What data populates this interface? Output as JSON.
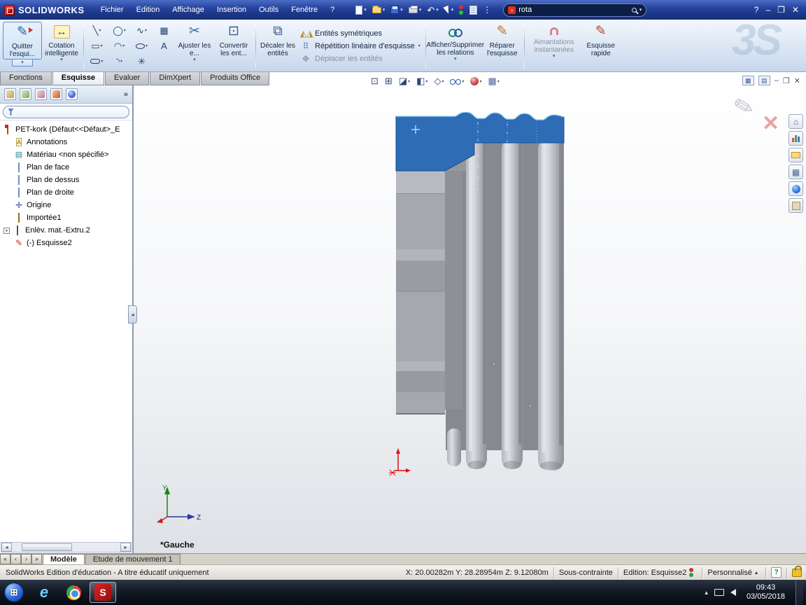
{
  "titlebar": {
    "app_name": "SOLIDWORKS",
    "menu": [
      "Fichier",
      "Edition",
      "Affichage",
      "Insertion",
      "Outils",
      "Fenêtre",
      "?"
    ],
    "search_value": "rota"
  },
  "icons": {
    "dropdown": "▾",
    "overflow": "»",
    "more_vertical": "⋮",
    "undo": "↶",
    "minimize": "–",
    "restore": "❐",
    "close": "✕",
    "help": "?",
    "plus": "+",
    "line": "╲",
    "circle": "◯",
    "spline": "∿",
    "hatch": "▦",
    "rectangle": "▭",
    "arc": "◠",
    "text": "A",
    "fillet": "◝",
    "point": "✳",
    "pencil": "✎",
    "dimension": "↔",
    "trim": "✂",
    "convert": "⊡",
    "offset": "⧉",
    "mirror": "◭◮",
    "pattern": "⠿",
    "move": "✥",
    "zoom_fit": "⊡",
    "zoom_area": "⊞",
    "section": "◪",
    "orientation": "◧",
    "display_style": "◇",
    "scene": "▦",
    "home": "⌂",
    "palette": "▦",
    "material": "▤",
    "origin": "✛",
    "annotation": "A",
    "collapse": "◂",
    "scroll_left": "◂",
    "scroll_right": "▸",
    "nav_first": "«",
    "nav_prev": "‹",
    "nav_next": "›",
    "nav_last": "»",
    "tray_arrow": "▴",
    "start_flag": "⊞",
    "ie_letter": "e",
    "sw_letter": "S",
    "search_brand": "›",
    "doc_box_a": "▦",
    "doc_box_b": "▤",
    "ds_watermark": "3S",
    "units_caret": "▴"
  },
  "ribbon": {
    "exit_sketch_label": "Quitter l'esqui...",
    "smart_dimension_label": "Cotation intelligente",
    "trim_label": "Ajuster les e...",
    "convert_label": "Convertir les ent...",
    "offset_label": "Décaler les entités",
    "mirror_label": "Entités symétriques",
    "linear_pattern_label": "Répétition linéaire d'esquisse",
    "move_label": "Déplacer les entités",
    "relations_label": "Afficher/Supprimer les relations",
    "repair_label": "Réparer l'esquisse",
    "snaps_label": "Aimantations instantanées",
    "rapid_label": "Esquisse rapide"
  },
  "command_tabs": [
    "Fonctions",
    "Esquisse",
    "Evaluer",
    "DimXpert",
    "Produits Office"
  ],
  "feature_tree": {
    "root": "PET-kork  (Défaut<<Défaut>_E",
    "items": [
      "Annotations",
      "Matériau <non spécifié>",
      "Plan de face",
      "Plan de dessus",
      "Plan de droite",
      "Origine",
      "Importée1",
      "Enlèv. mat.-Extru.2",
      "(-) Esquisse2"
    ]
  },
  "viewport": {
    "view_label": "*Gauche",
    "axis_y": "Y",
    "axis_z": "Z"
  },
  "model_tabs": [
    "Modèle",
    "Etude de mouvement 1"
  ],
  "statusbar": {
    "edition_notice": "SolidWorks Edition d'éducation - A titre éducatif uniquement",
    "coordinates": "X: 20.00282m Y: 28.28954m Z: 9.12080m",
    "constraint_state": "Sous-contrainte",
    "editing": "Edition: Esquisse2",
    "units": "Personnalisé"
  },
  "taskbar": {
    "time": "09:43",
    "date": "03/05/2018"
  },
  "colors": {
    "sketch_selection_blue": "#2e6cb6",
    "titlebar_blue": "#24409a"
  }
}
